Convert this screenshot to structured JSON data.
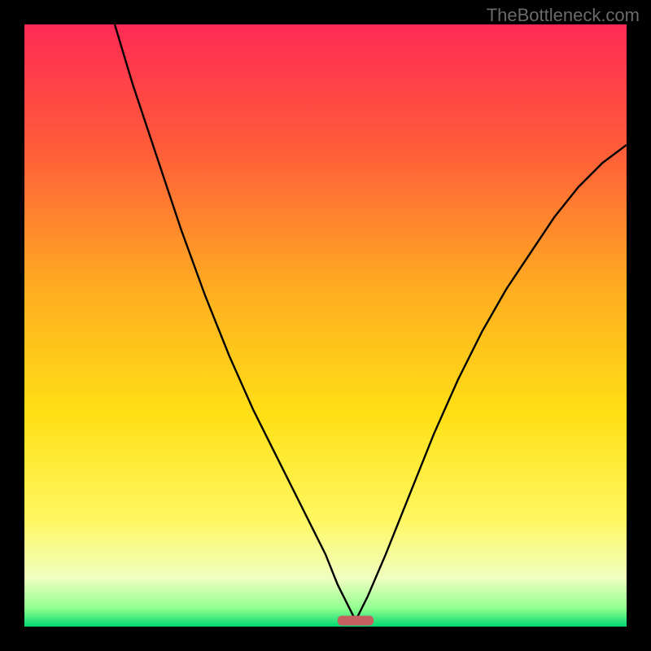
{
  "watermark": "TheBottleneck.com",
  "colors": {
    "page_bg": "#000000",
    "curve": "#000000",
    "marker": "#c56060",
    "gradient_stops": [
      {
        "offset": 0,
        "hex": "#ff2a55"
      },
      {
        "offset": 20,
        "hex": "#ff5a3a"
      },
      {
        "offset": 45,
        "hex": "#ffb020"
      },
      {
        "offset": 65,
        "hex": "#ffe015"
      },
      {
        "offset": 82,
        "hex": "#fff760"
      },
      {
        "offset": 92,
        "hex": "#f0ffc0"
      },
      {
        "offset": 97,
        "hex": "#90ff90"
      },
      {
        "offset": 100,
        "hex": "#00d870"
      }
    ]
  },
  "chart_data": {
    "type": "line",
    "title": "",
    "xlabel": "",
    "ylabel": "",
    "xlim": [
      0,
      100
    ],
    "ylim": [
      0,
      100
    ],
    "notch_x": 55,
    "marker": {
      "x_start": 52,
      "x_end": 58,
      "y": 1
    },
    "series": [
      {
        "name": "left-branch",
        "x": [
          15,
          18,
          22,
          26,
          30,
          34,
          38,
          42,
          46,
          50,
          52,
          54,
          55
        ],
        "values": [
          100,
          90,
          78,
          66,
          55,
          45,
          36,
          28,
          20,
          12,
          7,
          3,
          1
        ]
      },
      {
        "name": "right-branch",
        "x": [
          55,
          57,
          60,
          64,
          68,
          72,
          76,
          80,
          84,
          88,
          92,
          96,
          100
        ],
        "values": [
          1,
          5,
          12,
          22,
          32,
          41,
          49,
          56,
          62,
          68,
          73,
          77,
          80
        ]
      }
    ]
  }
}
